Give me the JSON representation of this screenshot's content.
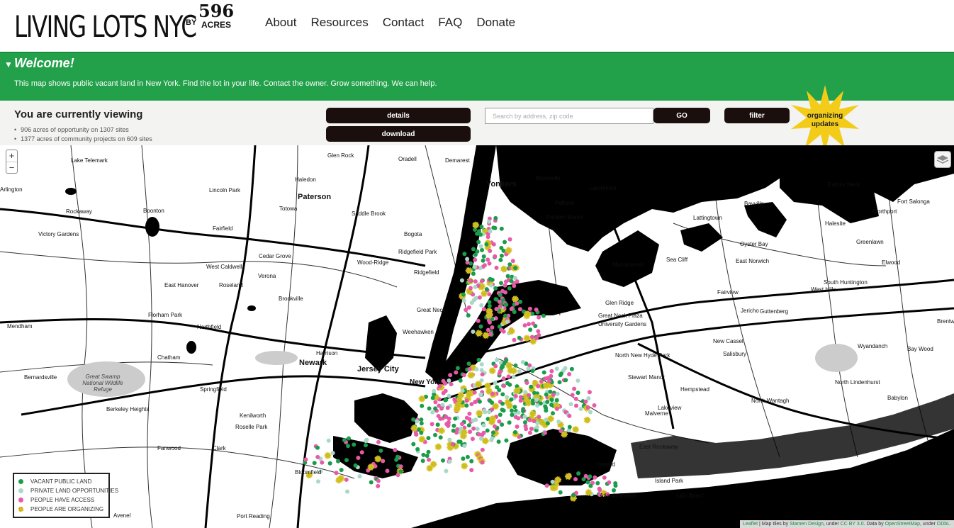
{
  "header": {
    "logo_main": "LIVING LOTS NYC",
    "logo_by": "BY",
    "logo_596": "596",
    "logo_acres": "ACRES",
    "nav": [
      "About",
      "Resources",
      "Contact",
      "FAQ",
      "Donate"
    ]
  },
  "welcome": {
    "toggle_icon": "triangle-down-icon",
    "title": "Welcome!",
    "text": "This map shows public vacant land in New York. Find the lot in your life. Contact the owner. Grow something. We can help."
  },
  "viewing": {
    "title": "You are currently viewing",
    "stats": [
      "906 acres of opportunity on 1307 sites",
      "1377 acres of community projects on 609 sites"
    ],
    "details_label": "details",
    "download_label": "download",
    "search_placeholder": "Search by address, zip code",
    "go_label": "GO",
    "filter_label": "filter",
    "organizing_label": "organizing updates"
  },
  "map": {
    "zoom_in": "+",
    "zoom_out": "−",
    "places": [
      {
        "name": "Glen Rock"
      },
      {
        "name": "Oradell"
      },
      {
        "name": "Demarest"
      },
      {
        "name": "Lake Telemark"
      },
      {
        "name": "Haledon"
      },
      {
        "name": "Yonkers"
      },
      {
        "name": "Bronxville"
      },
      {
        "name": "Larchmont"
      },
      {
        "name": "Eatons Neck"
      },
      {
        "name": "Fort Salonga"
      },
      {
        "name": "Lincoln Park"
      },
      {
        "name": "Paterson"
      },
      {
        "name": "Pelham"
      },
      {
        "name": "Bayville"
      },
      {
        "name": "Northport"
      },
      {
        "name": "Rockaway"
      },
      {
        "name": "Boonton"
      },
      {
        "name": "Totowa"
      },
      {
        "name": "Saddle Brook"
      },
      {
        "name": "Pelham Manor"
      },
      {
        "name": "Lattingtown"
      },
      {
        "name": "Halesite"
      },
      {
        "name": "Victory Gardens"
      },
      {
        "name": "Fairfield"
      },
      {
        "name": "Bogota"
      },
      {
        "name": "Oyster Bay"
      },
      {
        "name": "Greenlawn"
      },
      {
        "name": "Ridgefield Park"
      },
      {
        "name": "Cedar Grove"
      },
      {
        "name": "Wood-Ridge"
      },
      {
        "name": "West Caldwell"
      },
      {
        "name": "Ridgefield"
      },
      {
        "name": "Sea Cliff"
      },
      {
        "name": "Manorhaven"
      },
      {
        "name": "East Norwich"
      },
      {
        "name": "Elwood"
      },
      {
        "name": "Verona"
      },
      {
        "name": "East Hanover"
      },
      {
        "name": "Roseland"
      },
      {
        "name": "South Huntington"
      },
      {
        "name": "West Hills"
      },
      {
        "name": "Fairview"
      },
      {
        "name": "Brookville"
      },
      {
        "name": "Glen Ridge"
      },
      {
        "name": "Great Neck"
      },
      {
        "name": "Guttenberg"
      },
      {
        "name": "Florham Park"
      },
      {
        "name": "Jericho"
      },
      {
        "name": "Great Neck Plaza"
      },
      {
        "name": "Brentwood"
      },
      {
        "name": "Mendham"
      },
      {
        "name": "Northfield"
      },
      {
        "name": "University Gardens"
      },
      {
        "name": "Weehawken"
      },
      {
        "name": "New Cassel"
      },
      {
        "name": "Wyandanch"
      },
      {
        "name": "Harrison"
      },
      {
        "name": "Bay Wood"
      },
      {
        "name": "North New Hyde Park"
      },
      {
        "name": "Salisbury"
      },
      {
        "name": "Chatham"
      },
      {
        "name": "Newark"
      },
      {
        "name": "Jersey City"
      },
      {
        "name": "Bernardsville"
      },
      {
        "name": "Stewart Manor"
      },
      {
        "name": "North Lindenhurst"
      },
      {
        "name": "New York"
      },
      {
        "name": "Great Swamp National Wildlife Refuge"
      },
      {
        "name": "Springfield"
      },
      {
        "name": "Hempstead"
      },
      {
        "name": "Babylon"
      },
      {
        "name": "North Wantagh"
      },
      {
        "name": "Berkeley Heights"
      },
      {
        "name": "Lakeview"
      },
      {
        "name": "Malverne"
      },
      {
        "name": "Kenilworth"
      },
      {
        "name": "Roselle Park"
      },
      {
        "name": "Fanwood"
      },
      {
        "name": "Clark"
      },
      {
        "name": "East Rockaway"
      },
      {
        "name": "Bloomfield"
      },
      {
        "name": "Inwood"
      },
      {
        "name": "Island Park"
      },
      {
        "name": "Atlantic Beach"
      },
      {
        "name": "Lido Beach"
      },
      {
        "name": "Port Reading"
      },
      {
        "name": "Avenel"
      },
      {
        "name": "Arlington"
      }
    ]
  },
  "legend": {
    "items": [
      {
        "label": "VACANT PUBLIC LAND",
        "color": "#1a9d4a",
        "icon": "green-dot-icon"
      },
      {
        "label": "PRIVATE LAND OPPORTUNITIES",
        "color": "#a8d8c8",
        "icon": "light-dot-icon"
      },
      {
        "label": "PEOPLE HAVE ACCESS",
        "color": "#e85aa8",
        "icon": "pink-dot-icon"
      },
      {
        "label": "PEOPLE ARE ORGANIZING",
        "color": "#e8c020",
        "icon": "yellow-star-icon"
      }
    ]
  },
  "attribution": {
    "leaflet": "Leaflet",
    "text1": " | Map tiles by ",
    "stamen": "Stamen Design",
    "text2": ", under ",
    "ccby": "CC BY 3.0",
    "text3": ". Data by ",
    "osm": "OpenStreetMap",
    "text4": ", under ",
    "odbl": "ODbL."
  },
  "colors": {
    "green": "#22a14a",
    "dark": "#1b0f0d",
    "badge": "#f3cc1a"
  }
}
